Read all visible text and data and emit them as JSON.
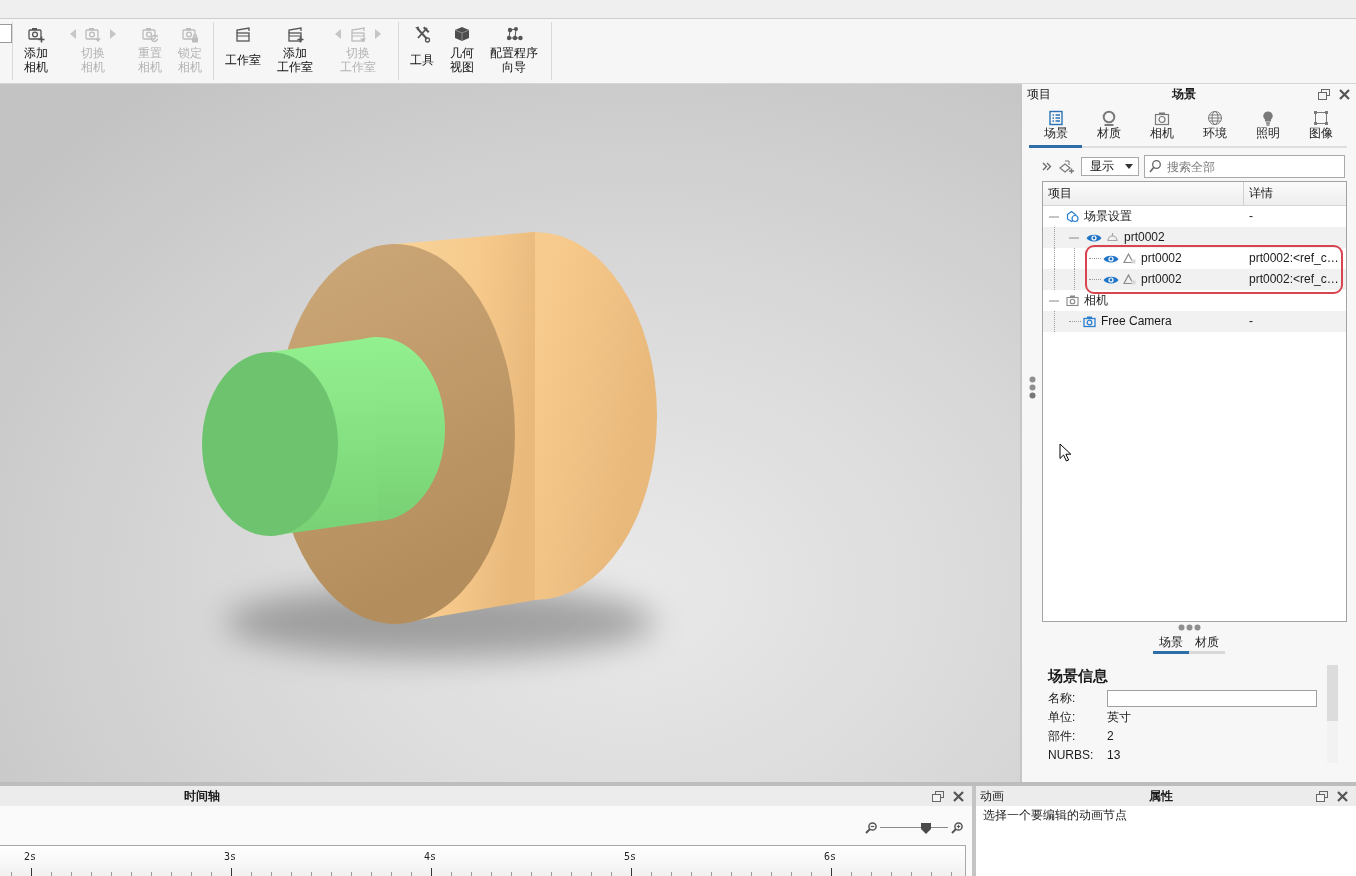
{
  "toolbar": {
    "groups": [
      {
        "buttons": [
          {
            "lines": [
              "添加",
              "相机"
            ],
            "kind": "plain",
            "disabled": false
          },
          {
            "lines": [
              "切换",
              "相机"
            ],
            "kind": "cycle",
            "disabled": true
          },
          {
            "lines": [
              "重置",
              "相机"
            ],
            "kind": "plain",
            "disabled": true
          },
          {
            "lines": [
              "锁定",
              "相机"
            ],
            "kind": "plain",
            "disabled": true
          }
        ]
      },
      {
        "buttons": [
          {
            "lines": [
              "工作室"
            ],
            "kind": "plain",
            "disabled": false
          },
          {
            "lines": [
              "添加",
              "工作室"
            ],
            "kind": "plain",
            "disabled": false
          },
          {
            "lines": [
              "切换",
              "工作室"
            ],
            "kind": "cycle",
            "disabled": true
          }
        ]
      },
      {
        "buttons": [
          {
            "lines": [
              "工具"
            ],
            "kind": "plain",
            "disabled": false
          },
          {
            "lines": [
              "几何",
              "视图"
            ],
            "kind": "plain",
            "disabled": false
          },
          {
            "lines": [
              "配置程序",
              "向导"
            ],
            "kind": "plain",
            "disabled": false
          }
        ]
      }
    ]
  },
  "project_panel": {
    "header_left": "项目",
    "title": "场景",
    "tabs": [
      {
        "label": "场景",
        "selected": true
      },
      {
        "label": "材质",
        "selected": false
      },
      {
        "label": "相机",
        "selected": false
      },
      {
        "label": "环境",
        "selected": false
      },
      {
        "label": "照明",
        "selected": false
      },
      {
        "label": "图像",
        "selected": false
      }
    ],
    "filter": {
      "display": "显示",
      "search_placeholder": "搜索全部"
    },
    "tree": {
      "columns": [
        "项目",
        "详情"
      ],
      "rows": [
        {
          "kind": "scene",
          "label": "场景设置",
          "detail": "-",
          "expanded": true,
          "children": [
            {
              "kind": "model",
              "label": "prt0002",
              "visible": true,
              "expanded": true,
              "children": [
                {
                  "kind": "part",
                  "label": "prt0002",
                  "detail": "prt0002:<ref_c…",
                  "visible": true,
                  "highlighted": true
                },
                {
                  "kind": "part",
                  "label": "prt0002",
                  "detail": "prt0002:<ref_c…",
                  "visible": true,
                  "highlighted": true
                }
              ]
            }
          ]
        },
        {
          "kind": "cameras",
          "label": "相机",
          "expanded": true,
          "children": [
            {
              "kind": "camera",
              "label": "Free Camera",
              "detail": "-"
            }
          ]
        }
      ]
    },
    "subtabs": [
      {
        "label": "场景",
        "selected": true
      },
      {
        "label": "材质",
        "selected": false
      }
    ],
    "scene_info": {
      "title": "场景信息",
      "fields": [
        {
          "label": "名称:",
          "kind": "input"
        },
        {
          "label": "单位:",
          "kind": "text",
          "value": "英寸"
        },
        {
          "label": "部件:",
          "kind": "text",
          "value": "2"
        },
        {
          "label": "NURBS:",
          "kind": "text",
          "value": "13"
        }
      ]
    }
  },
  "timeline": {
    "title": "时间轴",
    "zoom": {
      "level": 0.68
    },
    "ruler": [
      "2s",
      "3s",
      "4s",
      "5s",
      "6s"
    ]
  },
  "properties": {
    "tab": "动画",
    "title": "属性",
    "message": "选择一个要编辑的动画节点"
  }
}
